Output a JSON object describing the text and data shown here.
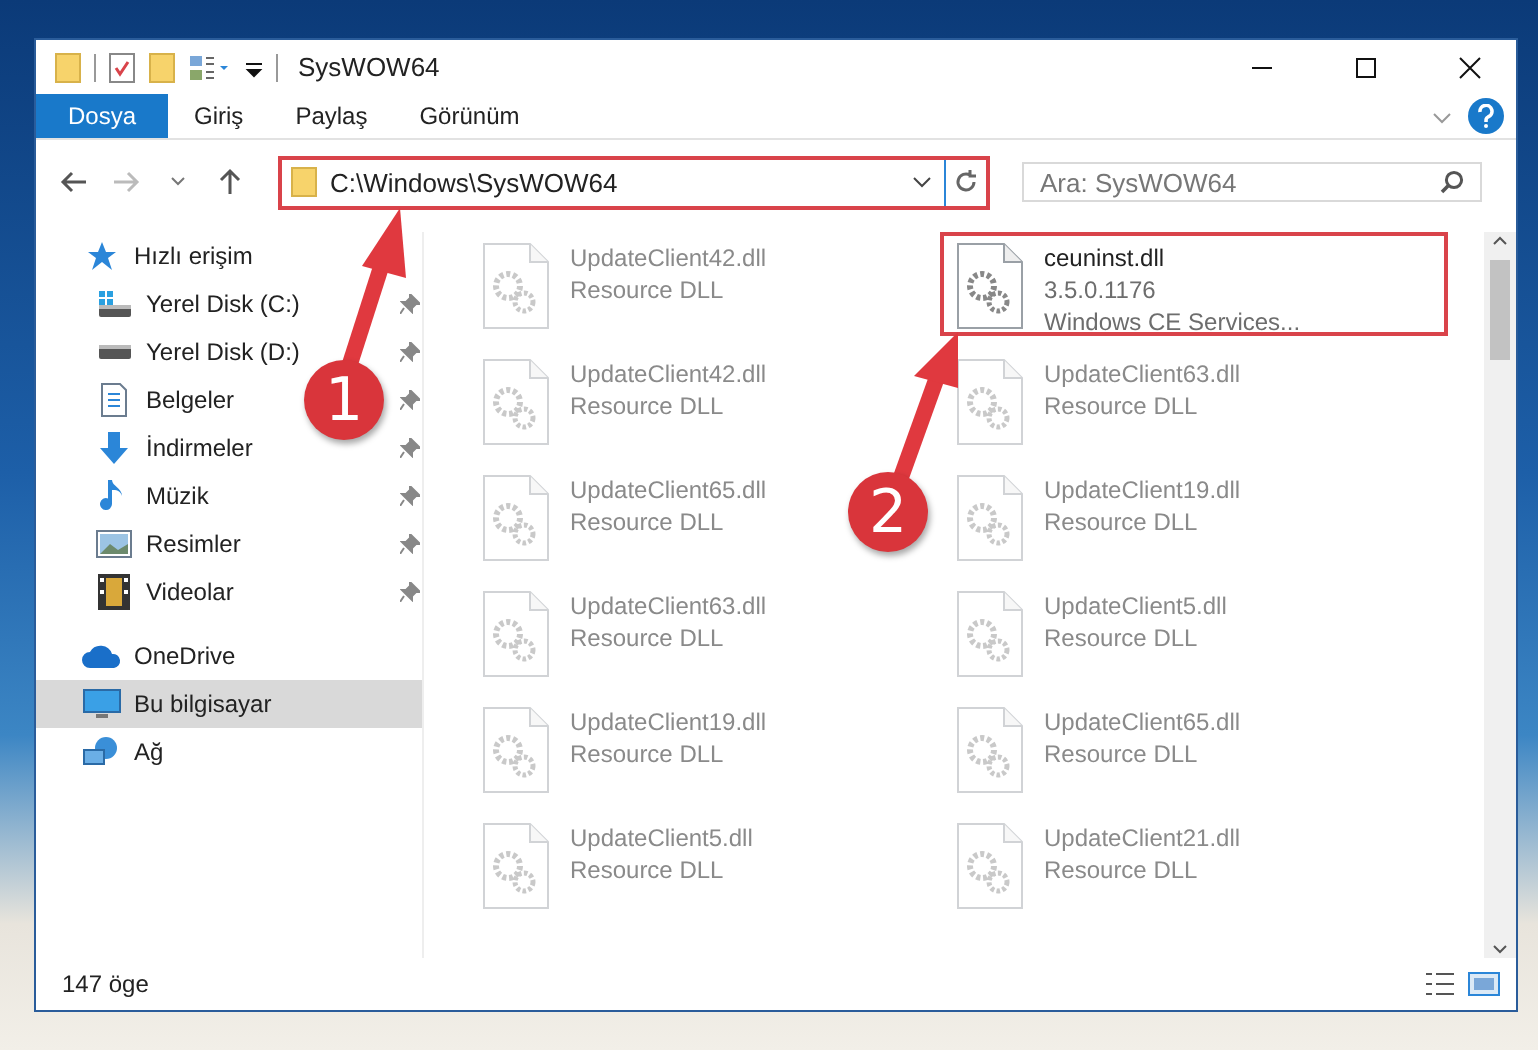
{
  "window": {
    "title": "SysWOW64"
  },
  "ribbon": {
    "tabs": [
      {
        "label": "Dosya",
        "selected": true
      },
      {
        "label": "Giriş",
        "selected": false
      },
      {
        "label": "Paylaş",
        "selected": false
      },
      {
        "label": "Görünüm",
        "selected": false
      }
    ]
  },
  "address": {
    "path": "C:\\Windows\\SysWOW64",
    "highlighted": true
  },
  "search": {
    "placeholder": "Ara: SysWOW64"
  },
  "sidebar": {
    "items": [
      {
        "label": "Hızlı erişim",
        "kind": "star",
        "selected": false,
        "children": [
          {
            "label": "Yerel Disk (C:)",
            "kind": "system-drive",
            "pinned": true,
            "selected": false
          },
          {
            "label": "Yerel Disk (D:)",
            "kind": "drive",
            "pinned": true,
            "selected": false
          },
          {
            "label": "Belgeler",
            "kind": "document",
            "pinned": true,
            "selected": false
          },
          {
            "label": "İndirmeler",
            "kind": "download",
            "pinned": true,
            "selected": false
          },
          {
            "label": "Müzik",
            "kind": "music",
            "pinned": true,
            "selected": false
          },
          {
            "label": "Resimler",
            "kind": "pictures",
            "pinned": true,
            "selected": false
          },
          {
            "label": "Videolar",
            "kind": "video",
            "pinned": true,
            "selected": false
          }
        ]
      },
      {
        "label": "OneDrive",
        "kind": "cloud",
        "selected": false
      },
      {
        "label": "Bu bilgisayar",
        "kind": "computer",
        "selected": true
      },
      {
        "label": "Ağ",
        "kind": "network",
        "selected": false
      }
    ]
  },
  "files": [
    {
      "name": "UpdateClient42.dll",
      "lines": [
        "Resource DLL"
      ],
      "blurred": true,
      "highlighted": false
    },
    {
      "name": "ceuninst.dll",
      "lines": [
        "3.5.0.1176",
        "Windows CE Services..."
      ],
      "blurred": false,
      "highlighted": true
    },
    {
      "name": "UpdateClient42.dll",
      "lines": [
        "Resource DLL"
      ],
      "blurred": true,
      "highlighted": false
    },
    {
      "name": "UpdateClient63.dll",
      "lines": [
        "Resource DLL"
      ],
      "blurred": true,
      "highlighted": false
    },
    {
      "name": "UpdateClient65.dll",
      "lines": [
        "Resource DLL"
      ],
      "blurred": true,
      "highlighted": false
    },
    {
      "name": "UpdateClient19.dll",
      "lines": [
        "Resource DLL"
      ],
      "blurred": true,
      "highlighted": false
    },
    {
      "name": "UpdateClient63.dll",
      "lines": [
        "Resource DLL"
      ],
      "blurred": true,
      "highlighted": false
    },
    {
      "name": "UpdateClient5.dll",
      "lines": [
        "Resource DLL"
      ],
      "blurred": true,
      "highlighted": false
    },
    {
      "name": "UpdateClient19.dll",
      "lines": [
        "Resource DLL"
      ],
      "blurred": true,
      "highlighted": false
    },
    {
      "name": "UpdateClient65.dll",
      "lines": [
        "Resource DLL"
      ],
      "blurred": true,
      "highlighted": false
    },
    {
      "name": "UpdateClient5.dll",
      "lines": [
        "Resource DLL"
      ],
      "blurred": true,
      "highlighted": false
    },
    {
      "name": "UpdateClient21.dll",
      "lines": [
        "Resource DLL"
      ],
      "blurred": true,
      "highlighted": false
    }
  ],
  "status_bar": {
    "count": "147 öge"
  },
  "annotations": [
    {
      "number": "1"
    },
    {
      "number": "2"
    }
  ]
}
